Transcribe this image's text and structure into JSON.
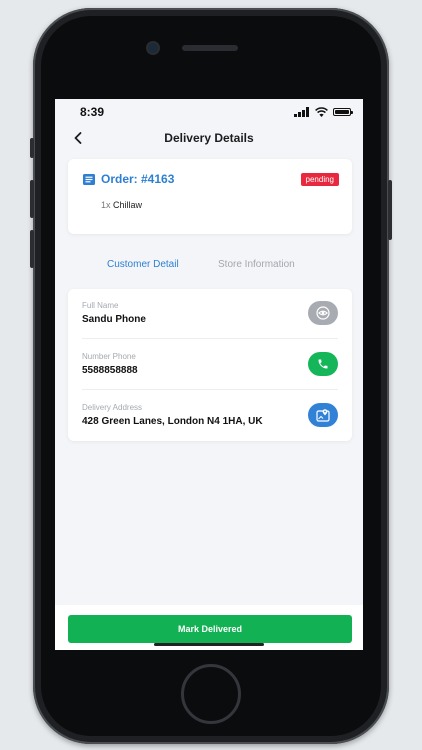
{
  "status_bar": {
    "time": "8:39"
  },
  "nav": {
    "title": "Delivery Details"
  },
  "order": {
    "title": "Order: #4163",
    "status": "pending",
    "items": [
      {
        "qty": "1x",
        "name": "Chillaw"
      }
    ]
  },
  "tabs": [
    {
      "label": "Customer Detail",
      "active": true
    },
    {
      "label": "Store Information",
      "active": false
    }
  ],
  "customer": {
    "name_label": "Full Name",
    "name_value": "Sandu Phone",
    "phone_label": "Number Phone",
    "phone_value": "5588858888",
    "address_label": "Delivery Address",
    "address_value": "428 Green Lanes, London N4 1HA, UK"
  },
  "actions": {
    "mark_delivered": "Mark Delivered"
  },
  "icons": {
    "back": "chevron-left-icon",
    "order": "list-icon",
    "profile": "eye-icon",
    "phone": "phone-icon",
    "map": "map-pin-icon"
  },
  "colors": {
    "accent": "#2d7fd3",
    "pending": "#e8283f",
    "success": "#12b254",
    "background": "#f4f5f8"
  }
}
